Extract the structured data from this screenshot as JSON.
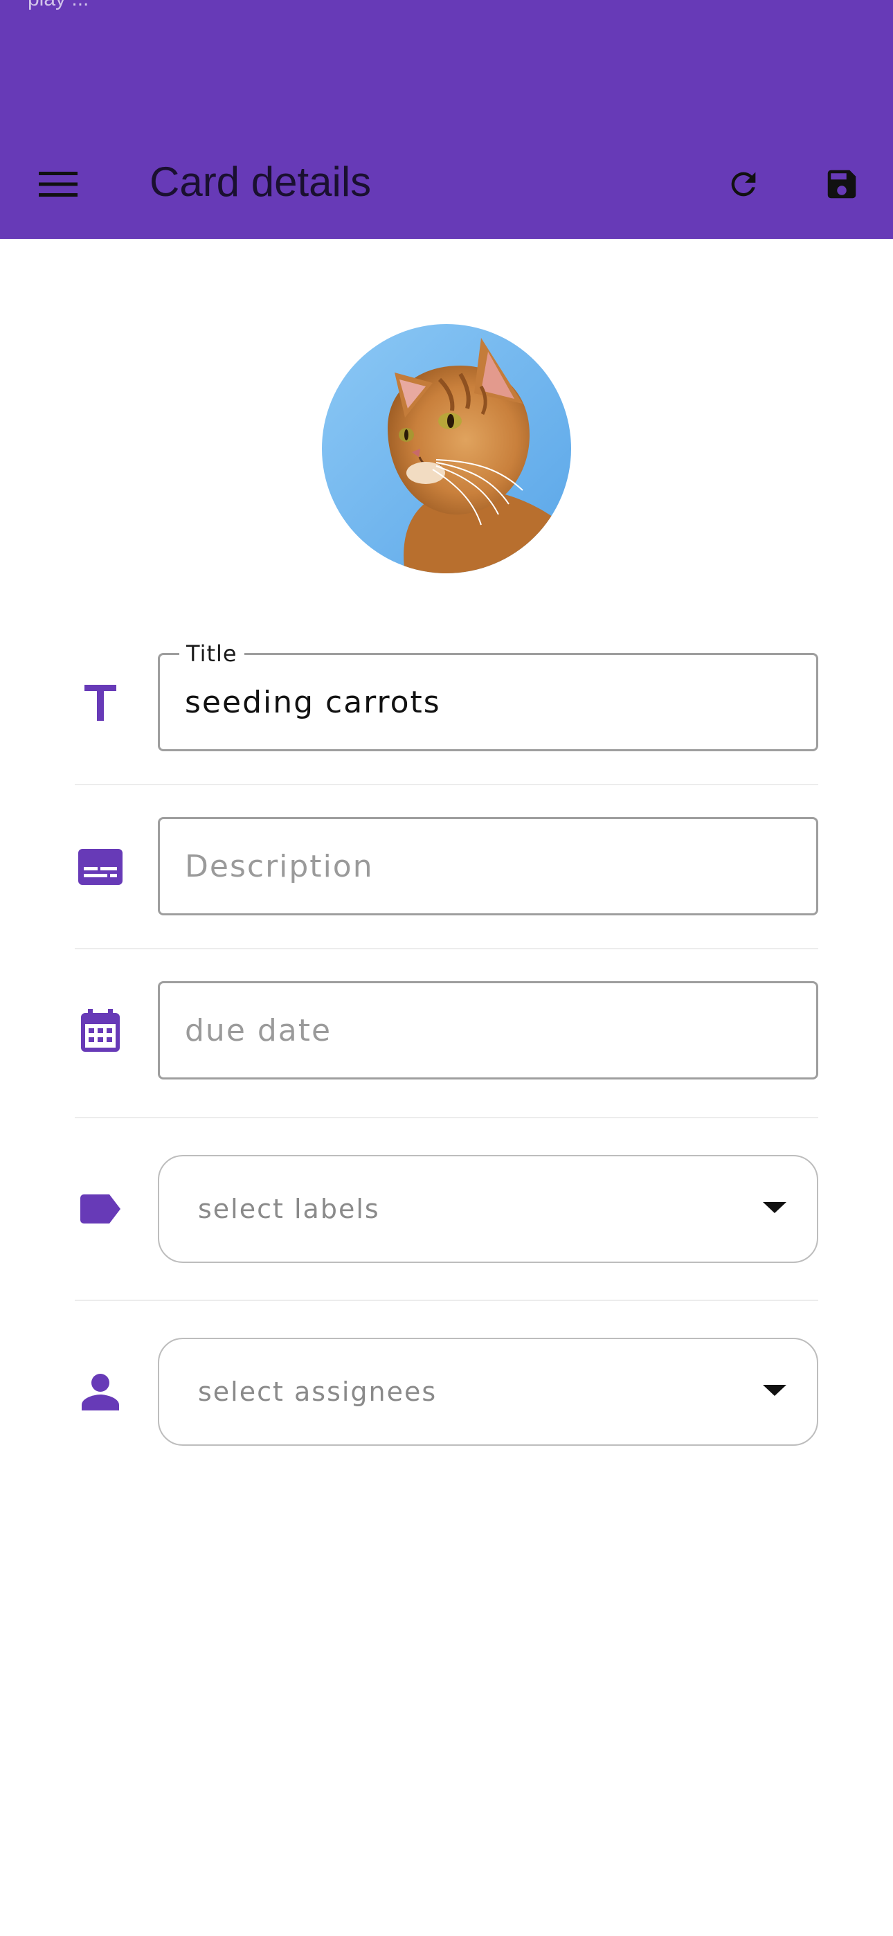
{
  "status_bar": {
    "text": "play ..."
  },
  "appbar": {
    "title": "Card details",
    "menu_icon": "menu-icon",
    "refresh_icon": "refresh-icon",
    "save_icon": "save-icon",
    "color": "#673ab7"
  },
  "form": {
    "title": {
      "label": "Title",
      "value": "seeding carrots",
      "icon": "title-text-icon"
    },
    "description": {
      "placeholder": "Description",
      "value": "",
      "icon": "description-icon"
    },
    "due_date": {
      "placeholder": "due date",
      "value": "",
      "icon": "calendar-icon"
    },
    "labels": {
      "placeholder": "select labels",
      "icon": "label-tag-icon"
    },
    "assignees": {
      "placeholder": "select assignees",
      "icon": "person-icon"
    }
  },
  "accent_color": "#673ab7"
}
